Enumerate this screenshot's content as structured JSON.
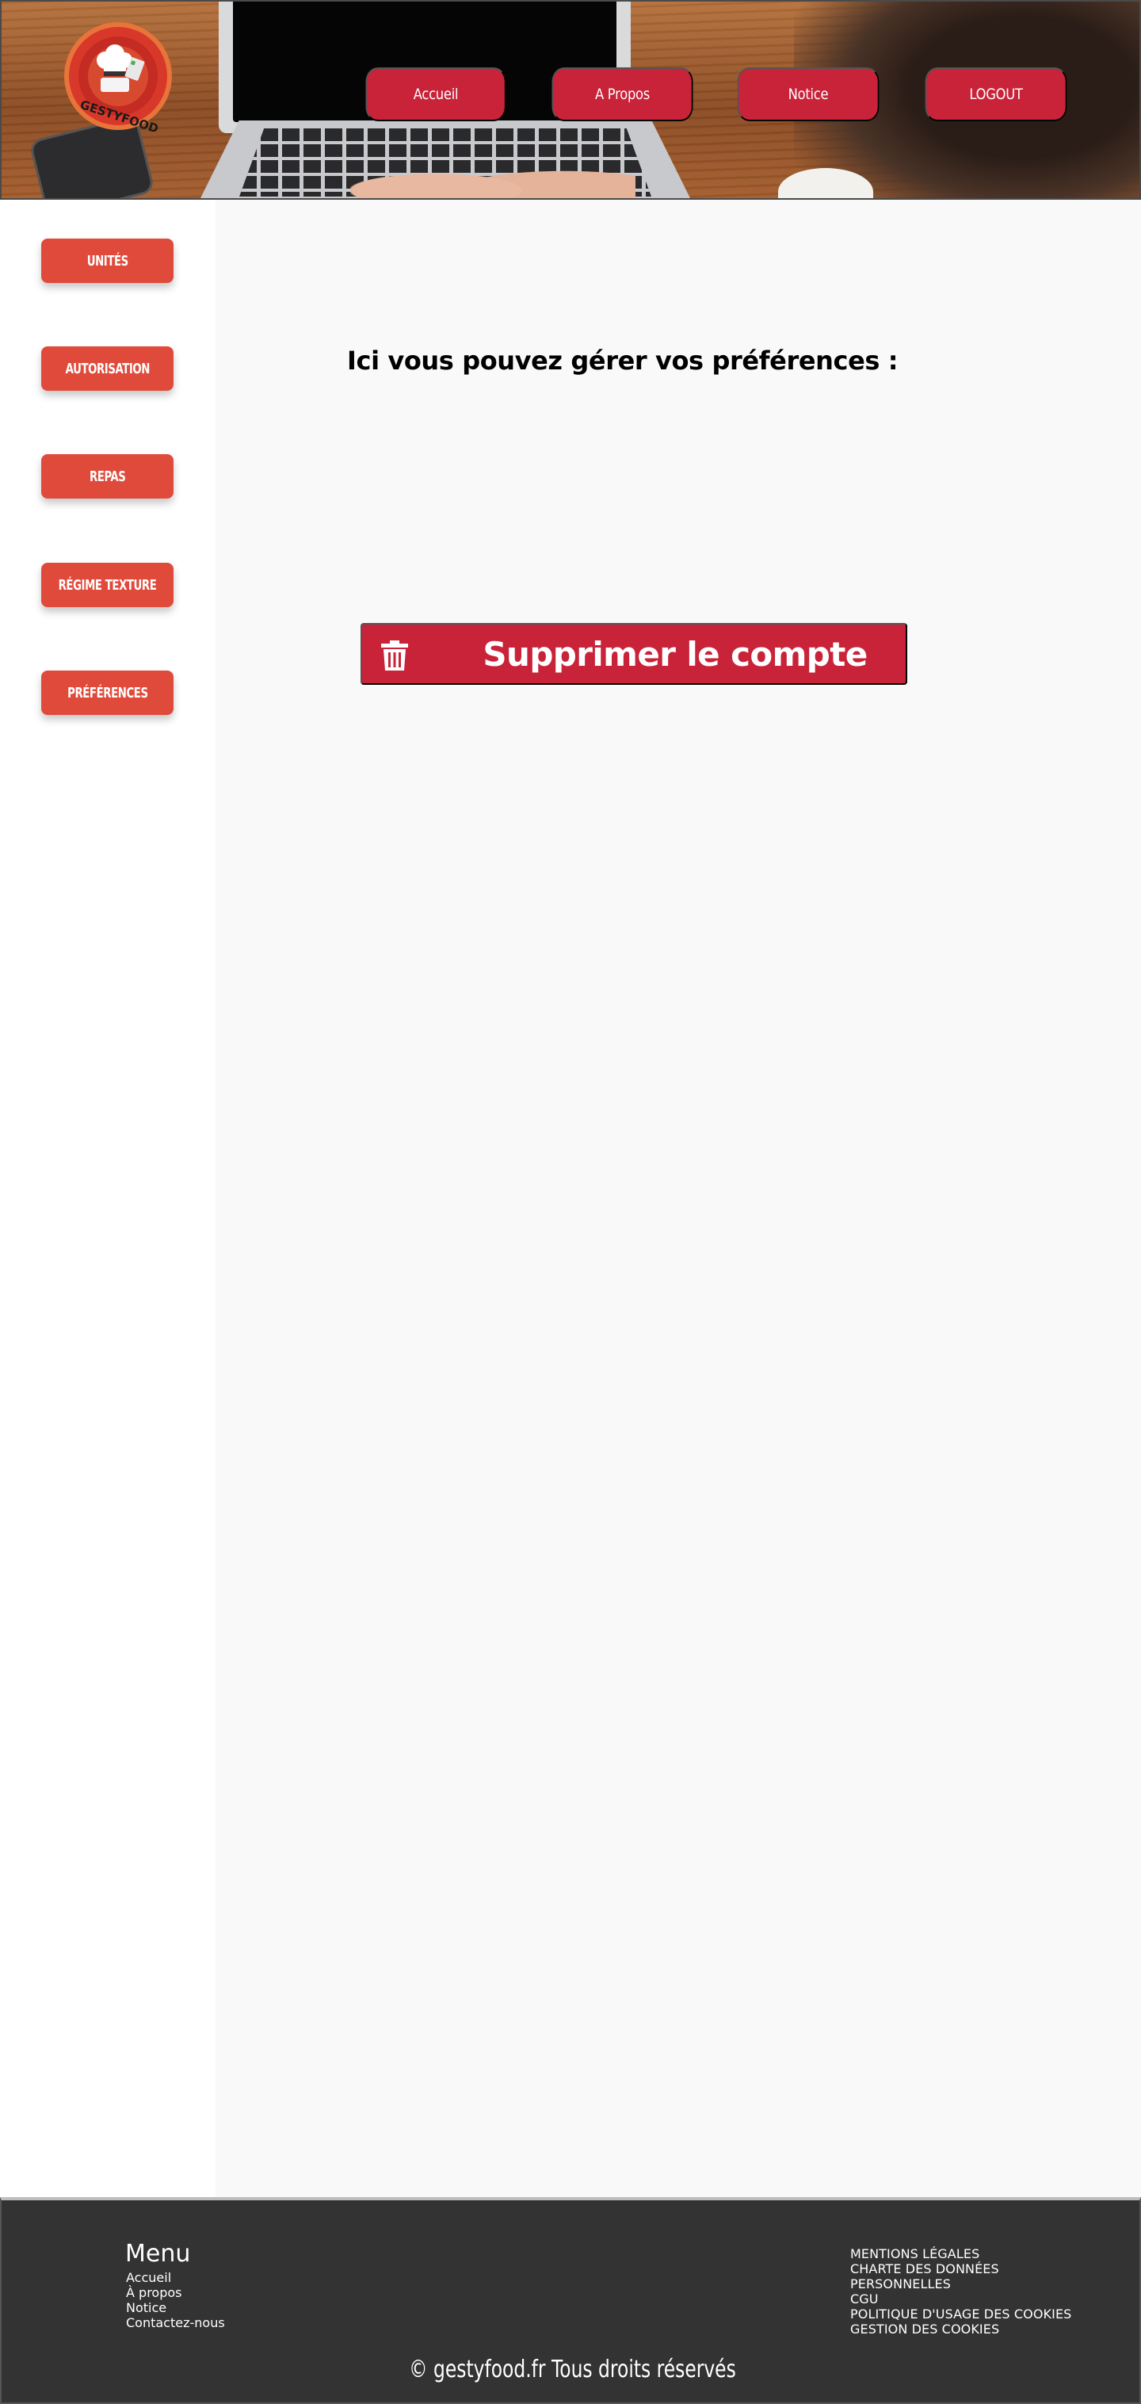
{
  "header": {
    "logo_text": "GESTYFOOD",
    "nav": [
      {
        "label": "Accueil"
      },
      {
        "label": "A Propos"
      },
      {
        "label": "Notice"
      },
      {
        "label": "LOGOUT"
      }
    ]
  },
  "sidebar": {
    "items": [
      {
        "label": "UNITÉS"
      },
      {
        "label": "AUTORISATION"
      },
      {
        "label": "REPAS"
      },
      {
        "label": "RÉGIME TEXTURE"
      },
      {
        "label": "PRÉFÉRENCES"
      }
    ]
  },
  "main": {
    "heading": "Ici vous pouvez gérer vos préférences :",
    "delete_account_label": "Supprimer le compte",
    "delete_icon": "trash-icon"
  },
  "footer": {
    "menu_title": "Menu",
    "menu_items": [
      "Accueil",
      "À propos",
      "Notice",
      "Contactez-nous"
    ],
    "legal_items": [
      "MENTIONS LÉGALES",
      "CHARTE DES DONNÉES",
      "PERSONNELLES",
      "CGU",
      "POLITIQUE D'USAGE DES COOKIES",
      "GESTION DES COOKIES"
    ],
    "copyright": "© gestyfood.fr  Tous droits réservés"
  },
  "colors": {
    "nav_button": "#c92339",
    "sidebar_button": "#e04a3a",
    "delete_button": "#c92339",
    "footer_bg": "#333333",
    "content_bg": "#f9f9f9"
  }
}
